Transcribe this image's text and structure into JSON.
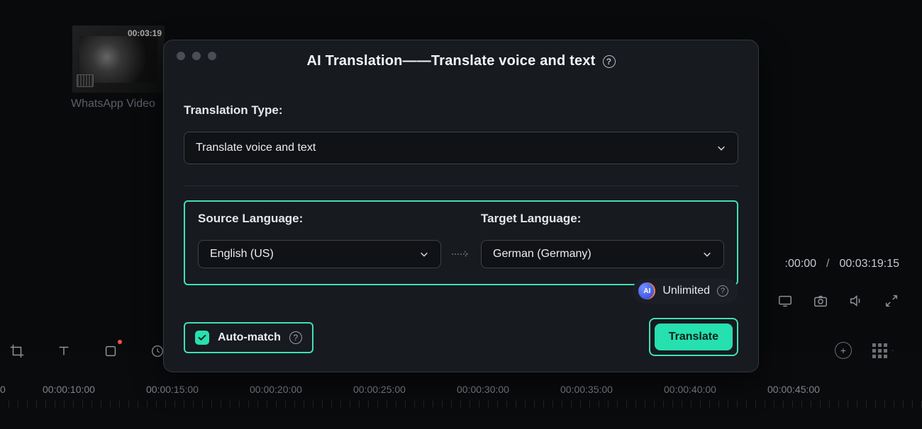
{
  "media": {
    "thumb_duration": "00:03:19",
    "label": "WhatsApp Video"
  },
  "viewer": {
    "current_time": ":00:00",
    "separator": "/",
    "total_time": "00:03:19:15"
  },
  "timeline": {
    "ticks": [
      "0",
      "00:00:10:00",
      "00:00:15:00",
      "00:00:20:00",
      "00:00:25:00",
      "00:00:30:00",
      "00:00:35:00",
      "00:00:40:00",
      "00:00:45:00"
    ]
  },
  "modal": {
    "title": "AI Translation——Translate voice and text",
    "type_label": "Translation Type:",
    "type_value": "Translate voice and text",
    "source_label": "Source Language:",
    "target_label": "Target Language:",
    "source_value": "English (US)",
    "target_value": "German (Germany)",
    "credits_label": "Unlimited",
    "ai_badge": "AI",
    "auto_match_label": "Auto-match",
    "translate_button": "Translate"
  }
}
